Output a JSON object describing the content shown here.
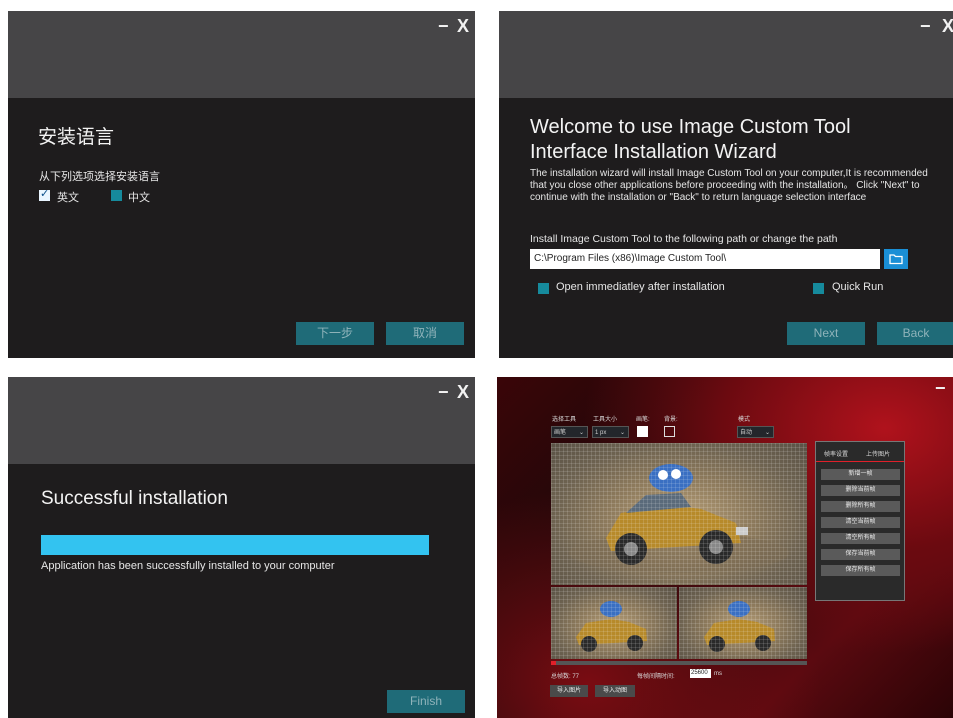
{
  "window_controls": {
    "minimize": "−",
    "close": "X"
  },
  "panel1": {
    "title": "安装语言",
    "prompt": "从下列选项选择安装语言",
    "options": [
      {
        "label": "英文",
        "checked": true
      },
      {
        "label": "中文",
        "checked": false
      }
    ],
    "next_label": "下一步",
    "cancel_label": "取消"
  },
  "panel2": {
    "title_line1": "Welcome to use Image Custom Tool",
    "title_line2": "Interface Installation Wizard",
    "description": "The installation wizard will install Image Custom Tool on your computer,It is recommended that you close other applications before proceeding with the installation。 Click \"Next\" to continue with the installation or \"Back\" to return language selection interface",
    "path_label": "Install Image Custom Tool to the following path or change the path",
    "path_value": "C:\\Program Files (x86)\\Image Custom Tool\\",
    "open_after_label": "Open immediatley after installation",
    "quick_run_label": "Quick Run",
    "next_label": "Next",
    "back_label": "Back"
  },
  "panel3": {
    "title": "Successful installation",
    "progress": 1.0,
    "message": "Application has been successfully installed to your computer",
    "finish_label": "Finish"
  },
  "panel4": {
    "minimize": "−",
    "toolbar": {
      "tool_label": "选择工具",
      "tool_value": "画笔",
      "size_label": "工具大小",
      "size_value": "1 px",
      "brush_label": "画笔:",
      "bg_label": "背景:",
      "mode_label": "模式",
      "mode_value": "自动"
    },
    "tabs": [
      "帧率设置",
      "上传图片"
    ],
    "menu_items": [
      "新增一帧",
      "删除当前帧",
      "删除所有帧",
      "清空当前帧",
      "清空所有帧",
      "保存当前帧",
      "保存所有帧"
    ],
    "frame_count_label": "总帧数: 77",
    "interval_label": "每帧间隔时间:",
    "interval_value": "25600",
    "interval_unit": "ms",
    "import_image_label": "导入图片",
    "import_gif_label": "导入动图",
    "progress": 0.02,
    "colors": {
      "accent": "#e0202a"
    }
  },
  "colors": {
    "panel_bg": "#1e1c1d",
    "titlebar_bg": "#464547",
    "button_bg": "#1f6b78",
    "progress_fill": "#33c3f0",
    "checkbox": "#168a9c"
  }
}
